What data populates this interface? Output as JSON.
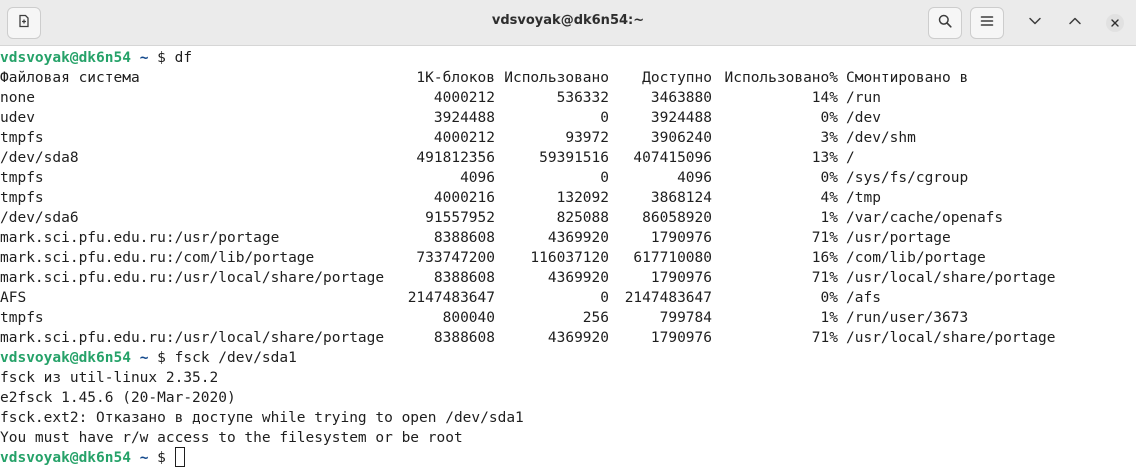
{
  "window": {
    "title": "vdsvoyak@dk6n54:~"
  },
  "headerbar": {
    "new_tab_icon": "new-tab-icon",
    "search_icon": "search-icon",
    "menu_icon": "hamburger-menu-icon",
    "minimize_icon": "chevron-down-icon",
    "maximize_icon": "chevron-up-icon",
    "close_icon": "close-icon"
  },
  "colors": {
    "prompt_user": "#26a269",
    "prompt_dir": "#12488b",
    "text": "#1e1e1e",
    "background": "#ffffff"
  },
  "prompt": {
    "user_host": "vdsvoyak@dk6n54",
    "dir": "~",
    "symbol": "$"
  },
  "commands": {
    "df": "df",
    "fsck": "fsck /dev/sda1",
    "current": ""
  },
  "df_table": {
    "headers": [
      "Файловая система",
      "1K-блоков",
      "Использовано",
      "Доступно",
      "Использовано%",
      "Смонтировано в"
    ],
    "rows": [
      [
        "none",
        "4000212",
        "536332",
        "3463880",
        "14%",
        "/run"
      ],
      [
        "udev",
        "3924488",
        "0",
        "3924488",
        "0%",
        "/dev"
      ],
      [
        "tmpfs",
        "4000212",
        "93972",
        "3906240",
        "3%",
        "/dev/shm"
      ],
      [
        "/dev/sda8",
        "491812356",
        "59391516",
        "407415096",
        "13%",
        "/"
      ],
      [
        "tmpfs",
        "4096",
        "0",
        "4096",
        "0%",
        "/sys/fs/cgroup"
      ],
      [
        "tmpfs",
        "4000216",
        "132092",
        "3868124",
        "4%",
        "/tmp"
      ],
      [
        "/dev/sda6",
        "91557952",
        "825088",
        "86058920",
        "1%",
        "/var/cache/openafs"
      ],
      [
        "mark.sci.pfu.edu.ru:/usr/portage",
        "8388608",
        "4369920",
        "1790976",
        "71%",
        "/usr/portage"
      ],
      [
        "mark.sci.pfu.edu.ru:/com/lib/portage",
        "733747200",
        "116037120",
        "617710080",
        "16%",
        "/com/lib/portage"
      ],
      [
        "mark.sci.pfu.edu.ru:/usr/local/share/portage",
        "8388608",
        "4369920",
        "1790976",
        "71%",
        "/usr/local/share/portage"
      ],
      [
        "AFS",
        "2147483647",
        "0",
        "2147483647",
        "0%",
        "/afs"
      ],
      [
        "tmpfs",
        "800040",
        "256",
        "799784",
        "1%",
        "/run/user/3673"
      ],
      [
        "mark.sci.pfu.edu.ru:/usr/local/share/portage",
        "8388608",
        "4369920",
        "1790976",
        "71%",
        "/usr/local/share/portage"
      ]
    ]
  },
  "fsck_output": [
    "fsck из util-linux 2.35.2",
    "e2fsck 1.45.6 (20-Mar-2020)",
    "fsck.ext2: Отказано в доступе while trying to open /dev/sda1",
    "You must have r/w access to the filesystem or be root"
  ]
}
